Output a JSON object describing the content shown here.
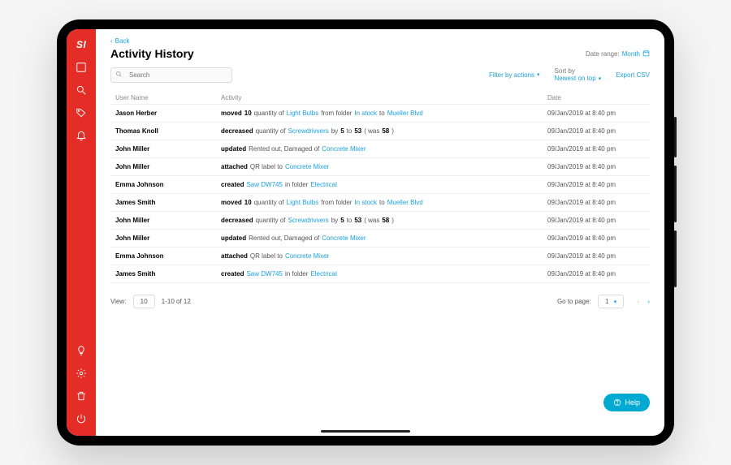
{
  "logo": "SI",
  "back": "Back",
  "title": "Activity History",
  "date_range": {
    "label": "Date range:",
    "value": "Month"
  },
  "search": {
    "placeholder": "Search"
  },
  "toolbar": {
    "filter": "Filter by actions",
    "sortby_label": "Sort by",
    "sortby_value": "Newest on top",
    "export": "Export CSV"
  },
  "columns": {
    "user": "User Name",
    "activity": "Activity",
    "date": "Date"
  },
  "rows": [
    {
      "user": "Jason Herber",
      "parts": [
        {
          "t": "moved",
          "c": "b"
        },
        {
          "t": "10",
          "c": "b"
        },
        {
          "t": "quantity of",
          "c": "g"
        },
        {
          "t": "Light Bulbs",
          "c": "l"
        },
        {
          "t": "from folder",
          "c": "g"
        },
        {
          "t": "In stock",
          "c": "l"
        },
        {
          "t": "to",
          "c": "g"
        },
        {
          "t": "Mueller Blvd",
          "c": "l"
        }
      ],
      "date": "09/Jan/2019 at 8:40 pm"
    },
    {
      "user": "Thomas Knoll",
      "parts": [
        {
          "t": "decreased",
          "c": "b"
        },
        {
          "t": "quantity of",
          "c": "g"
        },
        {
          "t": "Screwdrivvers",
          "c": "l"
        },
        {
          "t": "by",
          "c": "g"
        },
        {
          "t": "5",
          "c": "b"
        },
        {
          "t": "to",
          "c": "g"
        },
        {
          "t": "53",
          "c": "b"
        },
        {
          "t": "( was",
          "c": "g"
        },
        {
          "t": "58",
          "c": "b"
        },
        {
          "t": ")",
          "c": "g"
        }
      ],
      "date": "09/Jan/2019 at 8:40 pm"
    },
    {
      "user": "John Miller",
      "parts": [
        {
          "t": "updated",
          "c": "b"
        },
        {
          "t": "Rented out, Damaged of",
          "c": "g"
        },
        {
          "t": "Concrete Mixer",
          "c": "l"
        }
      ],
      "date": "09/Jan/2019 at 8:40 pm"
    },
    {
      "user": "John Miller",
      "parts": [
        {
          "t": "attached",
          "c": "b"
        },
        {
          "t": "QR label to",
          "c": "g"
        },
        {
          "t": "Concrete Mixer",
          "c": "l"
        }
      ],
      "date": "09/Jan/2019 at 8:40 pm"
    },
    {
      "user": "Emma Johnson",
      "parts": [
        {
          "t": "created",
          "c": "b"
        },
        {
          "t": "Saw DW745",
          "c": "l"
        },
        {
          "t": "in folder",
          "c": "g"
        },
        {
          "t": "Electrical",
          "c": "l"
        }
      ],
      "date": "09/Jan/2019 at 8:40 pm"
    },
    {
      "user": "James Smith",
      "parts": [
        {
          "t": "moved",
          "c": "b"
        },
        {
          "t": "10",
          "c": "b"
        },
        {
          "t": "quantity of",
          "c": "g"
        },
        {
          "t": "Light Bulbs",
          "c": "l"
        },
        {
          "t": "from folder",
          "c": "g"
        },
        {
          "t": "In stock",
          "c": "l"
        },
        {
          "t": "to",
          "c": "g"
        },
        {
          "t": "Mueller Blvd",
          "c": "l"
        }
      ],
      "date": "09/Jan/2019 at 8:40 pm"
    },
    {
      "user": "John Miller",
      "parts": [
        {
          "t": "decreased",
          "c": "b"
        },
        {
          "t": "quantity of",
          "c": "g"
        },
        {
          "t": "Screwdrivvers",
          "c": "l"
        },
        {
          "t": "by",
          "c": "g"
        },
        {
          "t": "5",
          "c": "b"
        },
        {
          "t": "to",
          "c": "g"
        },
        {
          "t": "53",
          "c": "b"
        },
        {
          "t": "( was",
          "c": "g"
        },
        {
          "t": "58",
          "c": "b"
        },
        {
          "t": ")",
          "c": "g"
        }
      ],
      "date": "09/Jan/2019 at 8:40 pm"
    },
    {
      "user": "John Miller",
      "parts": [
        {
          "t": "updated",
          "c": "b"
        },
        {
          "t": "Rented out, Damaged of",
          "c": "g"
        },
        {
          "t": "Concrete Mixer",
          "c": "l"
        }
      ],
      "date": "09/Jan/2019 at 8:40 pm"
    },
    {
      "user": "Emma Johnson",
      "parts": [
        {
          "t": "attached",
          "c": "b"
        },
        {
          "t": "QR label to",
          "c": "g"
        },
        {
          "t": "Concrete Mixer",
          "c": "l"
        }
      ],
      "date": "09/Jan/2019 at 8:40 pm"
    },
    {
      "user": "James Smith",
      "parts": [
        {
          "t": "created",
          "c": "b"
        },
        {
          "t": "Saw DW745",
          "c": "l"
        },
        {
          "t": "in folder",
          "c": "g"
        },
        {
          "t": "Electrical",
          "c": "l"
        }
      ],
      "date": "09/Jan/2019 at 8:40 pm"
    }
  ],
  "footer": {
    "view_label": "View:",
    "view_value": "10",
    "range": "1-10 of 12",
    "goto_label": "Go to page:",
    "page": "1"
  },
  "help": "Help"
}
